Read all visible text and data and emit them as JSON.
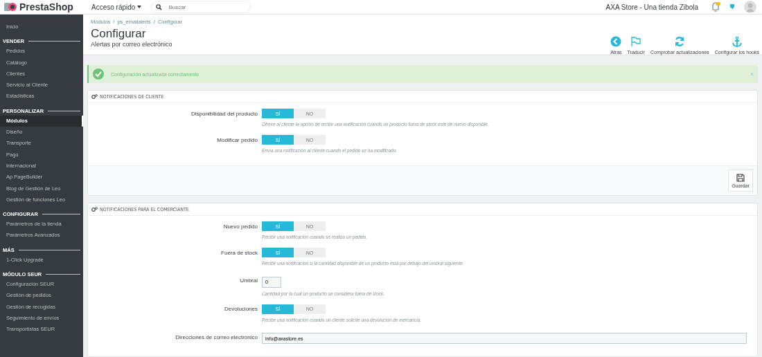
{
  "topbar": {
    "logo": "PrestaShop",
    "quick_access": "Acceso rápido",
    "search_placeholder": "Buscar",
    "shop_name": "AXA Store - Una tienda Zibola"
  },
  "sidebar": {
    "top_items": [
      {
        "label": "Inicio",
        "selected": false
      }
    ],
    "sections": [
      {
        "title": "VENDER",
        "items": [
          {
            "label": "Pedidos",
            "selected": false
          },
          {
            "label": "Catálogo",
            "selected": false
          },
          {
            "label": "Clientes",
            "selected": false
          },
          {
            "label": "Servicio al Cliente",
            "selected": false
          },
          {
            "label": "Estadísticas",
            "selected": false
          }
        ]
      },
      {
        "title": "PERSONALIZAR",
        "items": [
          {
            "label": "Módulos",
            "selected": true
          },
          {
            "label": "Diseño",
            "selected": false
          },
          {
            "label": "Transporte",
            "selected": false
          },
          {
            "label": "Pago",
            "selected": false
          },
          {
            "label": "Internacional",
            "selected": false
          },
          {
            "label": "Ap PageBuilder",
            "selected": false
          },
          {
            "label": "Blog de Gestión de Leo",
            "selected": false
          },
          {
            "label": "Gestión de funciones Leo",
            "selected": false
          }
        ]
      },
      {
        "title": "CONFIGURAR",
        "items": [
          {
            "label": "Parámetros de la tienda",
            "selected": false
          },
          {
            "label": "Parámetros Avanzados",
            "selected": false
          }
        ]
      },
      {
        "title": "MÁS",
        "items": [
          {
            "label": "1-Click Upgrade",
            "selected": false
          }
        ]
      },
      {
        "title": "MÓDULO SEUR",
        "items": [
          {
            "label": "Configuración SEUR",
            "selected": false
          },
          {
            "label": "Gestión de pedidos",
            "selected": false
          },
          {
            "label": "Gestión de recogidas",
            "selected": false
          },
          {
            "label": "Seguimiento de envíos",
            "selected": false
          },
          {
            "label": "Transportistas SEUR",
            "selected": false
          }
        ]
      }
    ]
  },
  "page_header": {
    "breadcrumb_separator": "/",
    "breadcrumb": [
      "Módulos",
      "ps_emailalerts",
      "Configurar"
    ],
    "title": "Configurar",
    "subtitle": "Alertas por correo electrónico",
    "toolbar": [
      {
        "kind": "back",
        "label": "Atrás"
      },
      {
        "kind": "flag",
        "label": "Traducir"
      },
      {
        "kind": "refresh",
        "label": "Comprobar actualizaciones"
      },
      {
        "kind": "anchor",
        "label": "Configurar los hooks"
      }
    ]
  },
  "alert": {
    "message": "Configuración actualizada correctamente",
    "close": "×"
  },
  "panels": [
    {
      "title": "NOTIFICACIONES DE CLIENTE",
      "save_button": "Guardar",
      "fields": [
        {
          "kind": "switch",
          "label": "Disponibilidad del producto",
          "on": true,
          "yes": "SÍ",
          "no": "NO",
          "help": "Ofrece al cliente la opción de recibir una notificación cuando un producto fuera de stock esté de nuevo disponible."
        },
        {
          "kind": "switch",
          "label": "Modificar pedido",
          "on": true,
          "yes": "SÍ",
          "no": "NO",
          "help": "Envía una notificación al cliente cuando el pedido se ha modificado."
        }
      ]
    },
    {
      "title": "NOTIFICACIONES PARA EL COMERCIANTE",
      "fields": [
        {
          "kind": "switch",
          "label": "Nuevo pedido",
          "on": true,
          "yes": "SÍ",
          "no": "NO",
          "help": "Recibir una notificación cuando se realiza un pedido."
        },
        {
          "kind": "switch",
          "label": "Fuera de stock",
          "on": true,
          "yes": "SÍ",
          "no": "NO",
          "help": "Recibir una notificación si la cantidad disponible de un producto está por debajo del umbral siguiente."
        },
        {
          "kind": "number",
          "label": "Umbral",
          "value": "0",
          "help": "Cantidad por la cual un producto se considera fuera de stock."
        },
        {
          "kind": "switch",
          "label": "Devoluciones",
          "on": true,
          "yes": "SÍ",
          "no": "NO",
          "help": "Recibe una notificación cuando un cliente solicite una devolución de mercancía."
        },
        {
          "kind": "text",
          "label": "Direcciones de correo electrónico",
          "value": "info@axastore.es"
        }
      ]
    }
  ]
}
